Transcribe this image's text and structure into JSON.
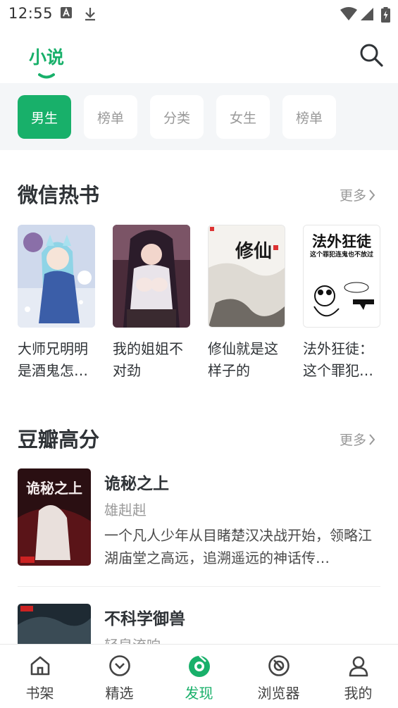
{
  "status_bar": {
    "time": "12:55"
  },
  "header": {
    "tab_title": "小说"
  },
  "chips": [
    "男生",
    "榜单",
    "分类",
    "女生",
    "榜单"
  ],
  "wechat_section": {
    "title": "微信热书",
    "more": "更多",
    "books": [
      {
        "title": "大师兄明明是酒鬼怎…"
      },
      {
        "title": "我的姐姐不对劲"
      },
      {
        "title": "修仙就是这样子的",
        "cover_text": "修仙",
        "cover_subtext": "修仙就是这样子的"
      },
      {
        "title": "法外狂徒：这个罪犯…",
        "cover_text": "法外狂徒",
        "cover_subtext": "这个罪犯连鬼也不放过"
      }
    ]
  },
  "douban_section": {
    "title": "豆瓣高分",
    "more": "更多",
    "items": [
      {
        "title": "诡秘之上",
        "author": "雄赳赳",
        "desc": "一个凡人少年从目睹楚汉决战开始，领略江湖庙堂之高远，追溯遥远的神话传…",
        "cover_text": "诡秘之上"
      },
      {
        "title": "不科学御兽",
        "author": "轻泉流响",
        "desc": ""
      }
    ]
  },
  "bottom_nav": [
    {
      "label": "书架",
      "icon": "home-icon"
    },
    {
      "label": "精选",
      "icon": "selection-icon"
    },
    {
      "label": "发现",
      "icon": "discover-icon",
      "active": true
    },
    {
      "label": "浏览器",
      "icon": "browser-icon"
    },
    {
      "label": "我的",
      "icon": "profile-icon"
    }
  ],
  "colors": {
    "accent": "#18b06a",
    "background_gray": "#f4f6f8",
    "text": "#2f3337",
    "muted": "#999999"
  }
}
